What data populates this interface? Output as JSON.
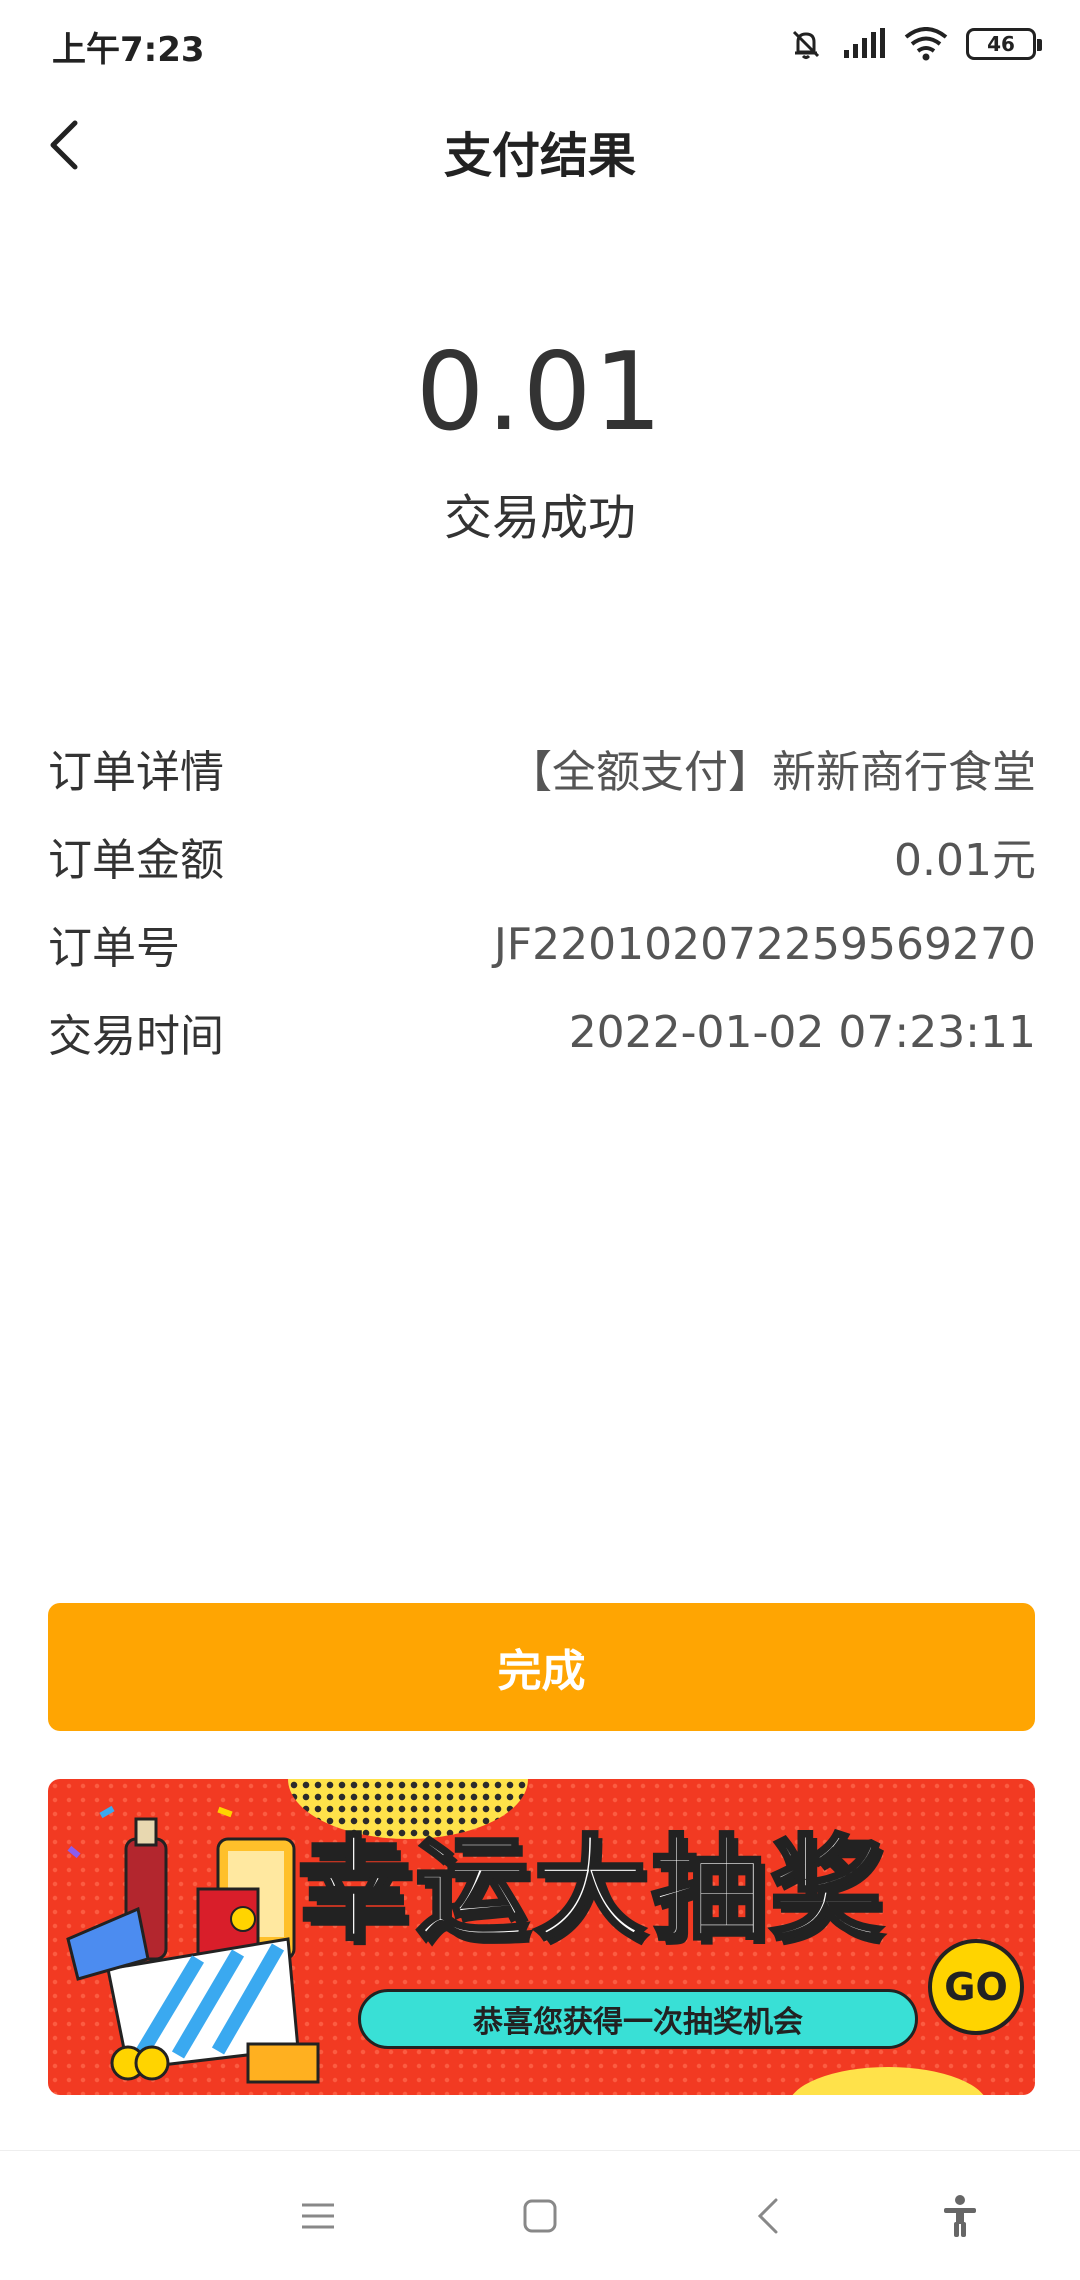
{
  "status_bar": {
    "time": "上午7:23",
    "battery": "46",
    "icons": [
      "bell-off-icon",
      "signal-icon",
      "wifi-icon",
      "battery-icon"
    ]
  },
  "header": {
    "title": "支付结果",
    "back_icon": "chevron-left-icon"
  },
  "result": {
    "amount": "0.01",
    "status": "交易成功"
  },
  "details": [
    {
      "label": "订单详情",
      "value": "【全额支付】新新商行食堂"
    },
    {
      "label": "订单金额",
      "value": "0.01元"
    },
    {
      "label": "订单号",
      "value": "JF220102072259569270"
    },
    {
      "label": "交易时间",
      "value": "2022-01-02 07:23:11"
    }
  ],
  "done_button": {
    "label": "完成"
  },
  "banner": {
    "title": "幸运大抽奖",
    "subtitle": "恭喜您获得一次抽奖机会",
    "go": "GO"
  },
  "colors": {
    "accent": "#FFA502",
    "banner_red": "#F23A22",
    "banner_cyan": "#39E0D6",
    "banner_yellow": "#FFD400"
  },
  "nav_bar": {
    "icons": [
      "menu-icon",
      "home-icon",
      "back-icon",
      "accessibility-icon"
    ]
  }
}
